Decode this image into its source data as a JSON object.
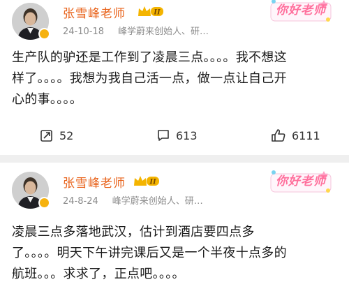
{
  "posts": [
    {
      "author": "张雪峰老师",
      "date": "24-10-18",
      "source": "峰学蔚来创始人、研…",
      "sticker": "你好老师",
      "lines": [
        "生产队的驴还是工作到了凌晨三点。。。。我不想这",
        "样了。。。。我想为我自己活一点，做一点让自己开",
        "心的事。。。。"
      ],
      "reposts": "52",
      "comments": "613",
      "likes": "6111"
    },
    {
      "author": "张雪峰老师",
      "date": "24-8-24",
      "source": "峰学蔚来创始人、研…",
      "sticker": "你好老师",
      "lines": [
        "凌晨三点多落地武汉，估计到酒店要四点多",
        "了。。。。明天下午讲完课后又是一个半夜十点多的",
        "航班。。。求求了，正点吧。。。。"
      ]
    }
  ],
  "colors": {
    "name": "#e8621a",
    "meta": "#8c8c8c",
    "separator": "#efefef",
    "sticker": "#ff6f9c"
  },
  "icons": [
    "avatar",
    "verified-badge-icon",
    "crown-level-icon",
    "repost-icon",
    "comment-icon",
    "like-icon"
  ]
}
